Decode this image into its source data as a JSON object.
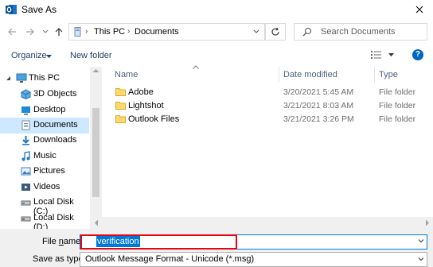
{
  "window": {
    "title": "Save As"
  },
  "address": {
    "crumbs": [
      "This PC",
      "Documents"
    ]
  },
  "search": {
    "placeholder": "Search Documents"
  },
  "toolbar": {
    "organize_label": "Organize",
    "new_folder_label": "New folder"
  },
  "nav_pane": {
    "items": [
      {
        "label": "This PC",
        "icon": "pc-icon"
      },
      {
        "label": "3D Objects",
        "icon": "3d-objects-icon"
      },
      {
        "label": "Desktop",
        "icon": "desktop-icon"
      },
      {
        "label": "Documents",
        "icon": "documents-icon",
        "selected": true
      },
      {
        "label": "Downloads",
        "icon": "downloads-icon"
      },
      {
        "label": "Music",
        "icon": "music-icon"
      },
      {
        "label": "Pictures",
        "icon": "pictures-icon"
      },
      {
        "label": "Videos",
        "icon": "videos-icon"
      },
      {
        "label": "Local Disk (C:)",
        "icon": "drive-icon"
      },
      {
        "label": "Local Disk (D:)",
        "icon": "drive-icon"
      }
    ]
  },
  "file_list": {
    "columns": [
      "Name",
      "Date modified",
      "Type"
    ],
    "rows": [
      {
        "name": "Adobe",
        "date": "3/20/2021 5:45 AM",
        "type": "File folder"
      },
      {
        "name": "Lightshot",
        "date": "3/21/2021 8:03 AM",
        "type": "File folder"
      },
      {
        "name": "Outlook Files",
        "date": "3/21/2021 3:26 PM",
        "type": "File folder"
      }
    ]
  },
  "save_form": {
    "file_name_label_prefix": "File ",
    "file_name_label_key": "n",
    "file_name_label_suffix": "ame:",
    "file_name_value": "verification",
    "save_as_type_label": "Save as type:",
    "save_as_type_value": "Outlook Message Format - Unicode (*.msg)"
  },
  "colors": {
    "accent": "#0078d7",
    "highlight_border": "#e30613",
    "selected_bg": "#cde8ff"
  }
}
